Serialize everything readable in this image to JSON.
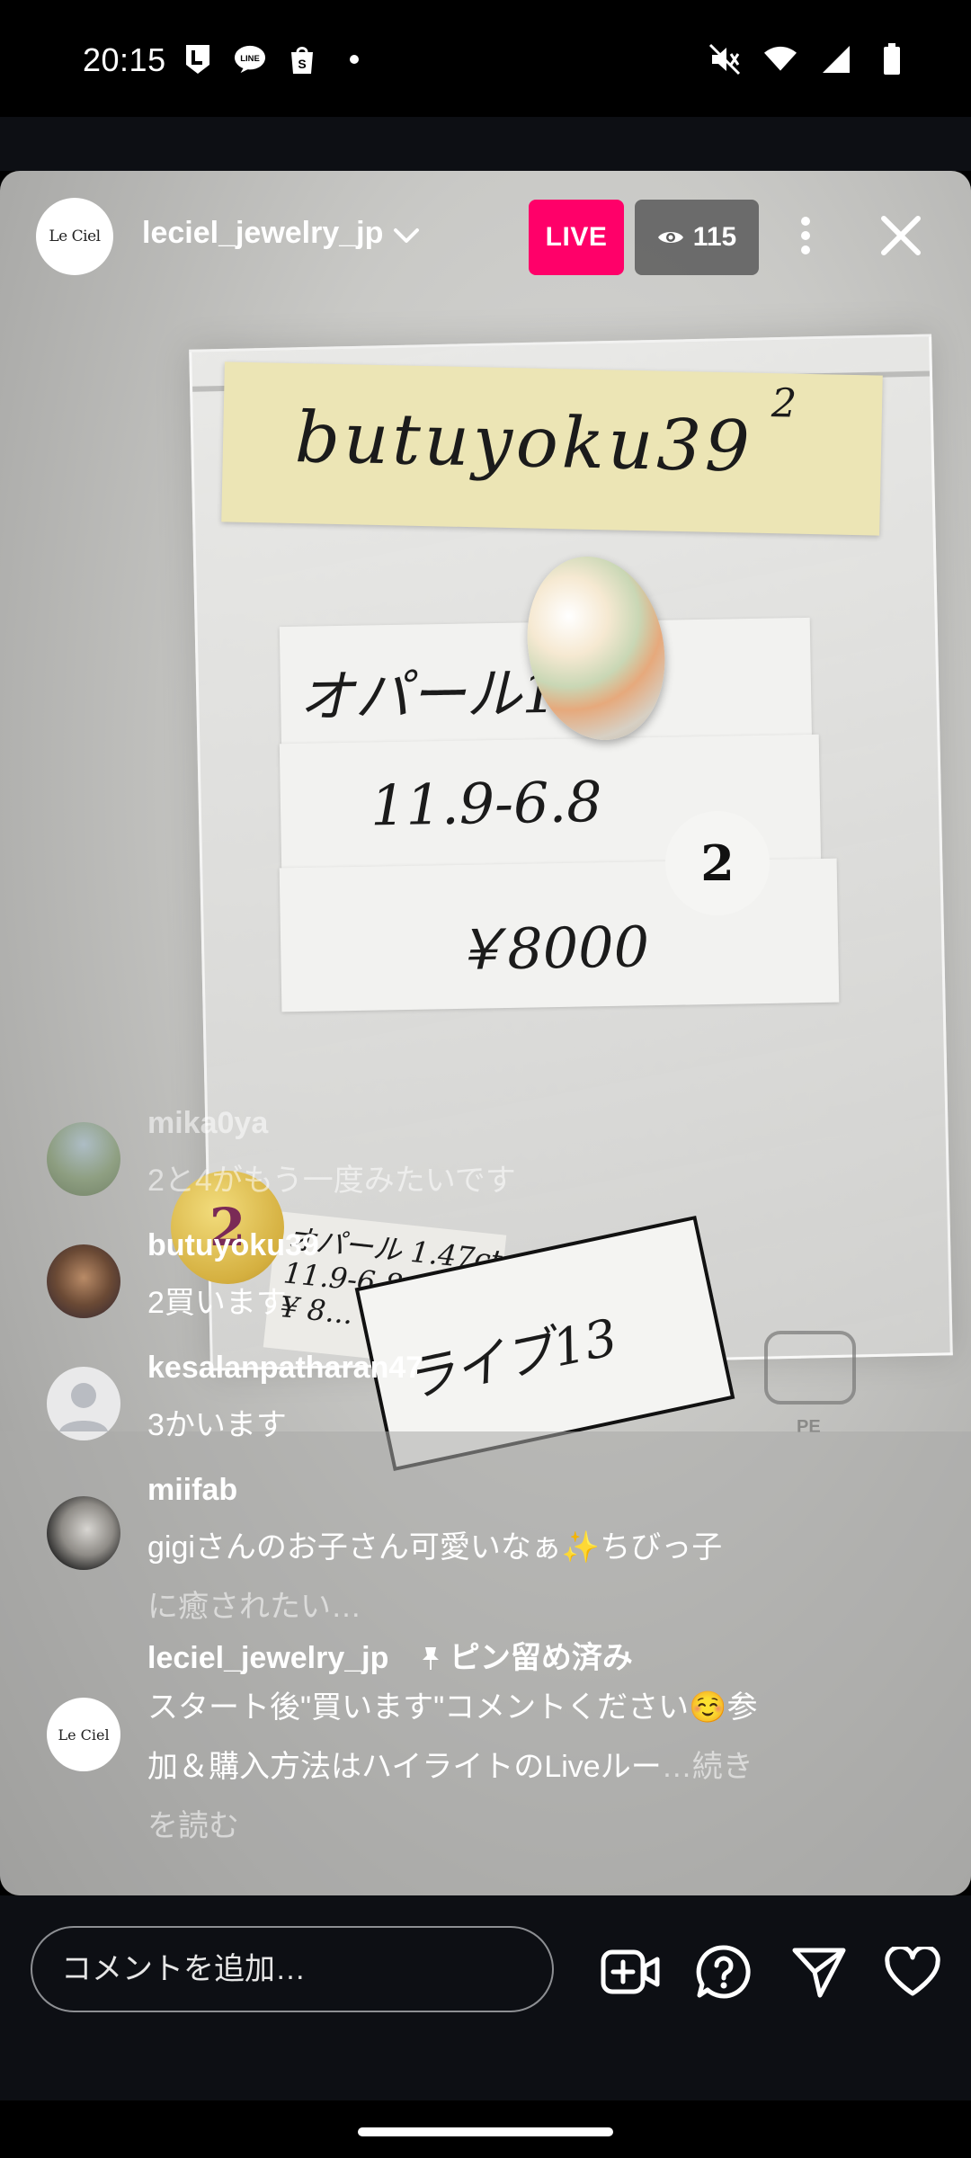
{
  "status_bar": {
    "time": "20:15",
    "left_icons": [
      "line-app-icon",
      "line-chat-icon",
      "shopify-icon",
      "dot-icon"
    ],
    "right_icons": [
      "mute-icon",
      "wifi-icon",
      "signal-icon",
      "battery-icon"
    ]
  },
  "header": {
    "avatar_text": "Le Ciel",
    "host_username": "leciel_jewelry_jp",
    "live_label": "LIVE",
    "viewer_count": "115"
  },
  "video_scene": {
    "tag_username": "butuyoku39",
    "tag_superscript": "2",
    "slip_lines": [
      "オパール1.47",
      "11.9-6.8",
      "￥8000"
    ],
    "sticker_number": "2",
    "gold_sticker_number": "2",
    "small_tag_lines": [
      "オパール 1.47ct",
      "11.9-6.8",
      "¥ 8..."
    ],
    "card_text": "ライブ13",
    "logo_sub": "PE"
  },
  "comments": [
    {
      "user": "mika0ya",
      "text": "2と4がもう一度みたいです"
    },
    {
      "user": "butuyoku39",
      "text": "2買います"
    },
    {
      "user": "kesalanpatharan47",
      "text": "3かいます"
    },
    {
      "user": "miifab",
      "text_line1": "gigiさんのお子さん可愛いなぁ✨ちびっ子",
      "text_line2": "に癒されたい…"
    },
    {
      "user": "leciel_jewelry_jp",
      "pin_label": "ピン留め済み",
      "text_line1": "スタート後\"買います\"コメントください☺️参",
      "text_line2": "加＆購入方法はハイライトのLiveルー",
      "more_label": "…続き",
      "more_line2": "を読む"
    }
  ],
  "bottom_bar": {
    "comment_placeholder": "コメントを追加…",
    "icons": [
      "add-video-icon",
      "question-icon",
      "send-icon",
      "heart-icon"
    ]
  },
  "colors": {
    "live_badge": "#ff0069",
    "background": "#0d0f14"
  }
}
